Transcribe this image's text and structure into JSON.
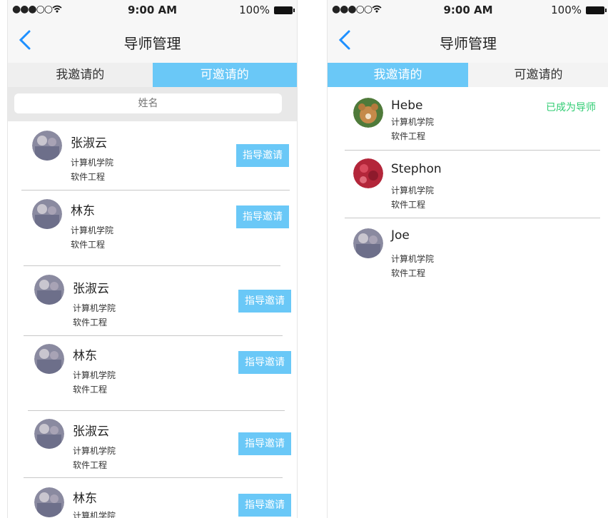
{
  "status_bar": {
    "signal": "●●●○○",
    "time": "9:00 AM",
    "battery": "100%"
  },
  "left": {
    "nav_title": "导师管理",
    "tabs": [
      "我邀请的",
      "可邀请的"
    ],
    "search_placeholder": "姓名",
    "items": [
      {
        "name": "张淑云",
        "college": "计算机学院",
        "major": "软件工程",
        "action": "指导邀请"
      },
      {
        "name": "林东",
        "college": "计算机学院",
        "major": "软件工程",
        "action": "指导邀请"
      },
      {
        "name": "张淑云",
        "college": "计算机学院",
        "major": "软件工程",
        "action": "指导邀请"
      },
      {
        "name": "林东",
        "college": "计算机学院",
        "major": "软件工程",
        "action": "指导邀请"
      },
      {
        "name": "张淑云",
        "college": "计算机学院",
        "major": "软件工程",
        "action": "指导邀请"
      },
      {
        "name": "林东",
        "college": "计算机学院",
        "major": "",
        "action": "指导邀请"
      }
    ]
  },
  "right": {
    "nav_title": "导师管理",
    "tabs": [
      "我邀请的",
      "可邀请的"
    ],
    "items": [
      {
        "name": "Hebe",
        "college": "计算机学院",
        "major": "软件工程",
        "status": "已成为导师"
      },
      {
        "name": "Stephon",
        "college": "计算机学院",
        "major": "软件工程",
        "status": ""
      },
      {
        "name": "Joe",
        "college": "计算机学院",
        "major": "软件工程",
        "status": ""
      }
    ]
  },
  "colors": {
    "accent": "#6ac8f7",
    "success": "#2ecc71",
    "back": "#1e90ff"
  }
}
